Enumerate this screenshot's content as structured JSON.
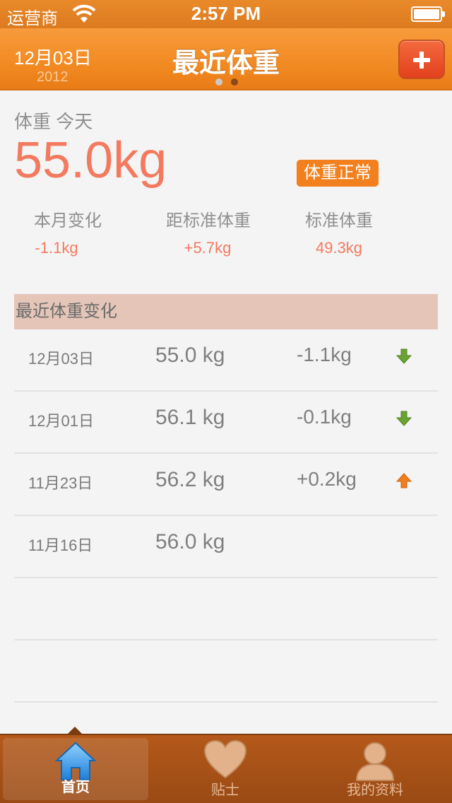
{
  "status_bar": {
    "carrier": "运营商",
    "time": "2:57 PM"
  },
  "nav": {
    "date": "12月03日",
    "year": "2012",
    "title": "最近体重",
    "page_index": 2,
    "page_count": 2
  },
  "summary": {
    "label": "体重 今天",
    "weight": "55.0kg",
    "status": "体重正常",
    "stats": [
      {
        "label": "本月变化",
        "value": "-1.1kg"
      },
      {
        "label": "距标准体重",
        "value": "+5.7kg"
      },
      {
        "label": "标准体重",
        "value": "49.3kg"
      }
    ]
  },
  "history": {
    "title": "最近体重变化",
    "rows": [
      {
        "date": "12月03日",
        "weight": "55.0 kg",
        "change": "-1.1kg",
        "trend": "down"
      },
      {
        "date": "12月01日",
        "weight": "56.1 kg",
        "change": "-0.1kg",
        "trend": "down"
      },
      {
        "date": "11月23日",
        "weight": "56.2 kg",
        "change": "+0.2kg",
        "trend": "up"
      },
      {
        "date": "11月16日",
        "weight": "56.0 kg",
        "change": "",
        "trend": ""
      }
    ]
  },
  "tabs": [
    {
      "label": "首页",
      "icon": "home-icon",
      "active": true
    },
    {
      "label": "贴士",
      "icon": "heart-icon",
      "active": false
    },
    {
      "label": "我的资料",
      "icon": "person-icon",
      "active": false
    }
  ],
  "colors": {
    "accent": "#f28a22",
    "weight": "#f37a5f",
    "down_arrow": "#6aa331",
    "up_arrow": "#f07e1c"
  }
}
